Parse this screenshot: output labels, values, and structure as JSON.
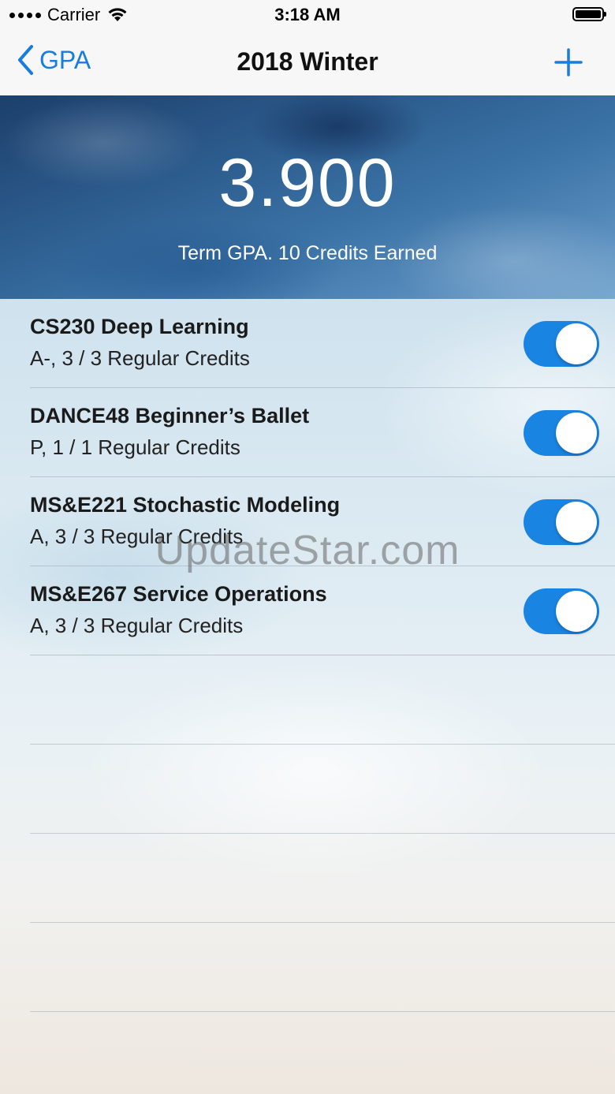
{
  "status_bar": {
    "carrier": "Carrier",
    "time": "3:18 AM"
  },
  "nav": {
    "back_label": "GPA",
    "title": "2018 Winter",
    "add_icon": "plus-icon"
  },
  "summary": {
    "gpa": "3.900",
    "caption": "Term GPA. 10 Credits Earned"
  },
  "courses": [
    {
      "name": "CS230 Deep Learning",
      "detail": "A-, 3 / 3 Regular Credits",
      "enabled": true
    },
    {
      "name": "DANCE48 Beginner’s Ballet",
      "detail": "P, 1 / 1 Regular Credits",
      "enabled": true
    },
    {
      "name": "MS&E221 Stochastic Modeling",
      "detail": "A, 3 / 3 Regular Credits",
      "enabled": true
    },
    {
      "name": "MS&E267 Service Operations",
      "detail": "A, 3 / 3 Regular Credits",
      "enabled": true
    }
  ],
  "watermark": "UpdateStar.com",
  "colors": {
    "accent": "#1a84e3",
    "nav_tint": "#1a7ce0"
  }
}
